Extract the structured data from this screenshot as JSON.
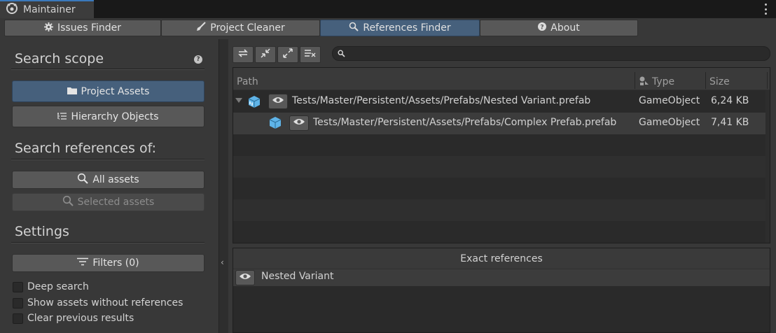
{
  "window": {
    "title": "Maintainer",
    "menu_icon": "kebab-icon"
  },
  "tabs": [
    {
      "label": "Issues Finder",
      "icon": "gear-icon",
      "active": false
    },
    {
      "label": "Project Cleaner",
      "icon": "broom-icon",
      "active": false
    },
    {
      "label": "References Finder",
      "icon": "search-icon",
      "active": true
    },
    {
      "label": "About",
      "icon": "help-icon",
      "active": false
    }
  ],
  "left": {
    "search_scope": {
      "title": "Search scope",
      "help_glyph": "?",
      "project_assets": "Project Assets",
      "hierarchy_objects": "Hierarchy Objects"
    },
    "search_refs": {
      "title": "Search references of:",
      "all_assets": "All assets",
      "selected_assets": "Selected assets"
    },
    "settings": {
      "title": "Settings",
      "filters": "Filters (0)",
      "deep_search": "Deep search",
      "show_without_refs": "Show assets without references",
      "clear_previous": "Clear previous results"
    }
  },
  "splitter": {
    "glyph": "‹"
  },
  "right": {
    "search": {
      "value": "",
      "placeholder": ""
    },
    "columns": {
      "path": "Path",
      "type": "Type",
      "size": "Size"
    },
    "rows": [
      {
        "path": "Tests/Master/Persistent/Assets/Prefabs/Nested Variant.prefab",
        "type": "GameObject",
        "size": "6,24 KB",
        "icon": "prefab-variant-icon",
        "expanded": true
      },
      {
        "path": "Tests/Master/Persistent/Assets/Prefabs/Complex Prefab.prefab",
        "type": "GameObject",
        "size": "7,41 KB",
        "icon": "prefab-icon",
        "expanded": false
      }
    ],
    "exact_refs": {
      "title": "Exact references",
      "items": [
        {
          "label": "Nested Variant"
        }
      ]
    }
  },
  "colors": {
    "accent": "#46607c",
    "background": "#383838",
    "panel_dark": "#2a2a2a",
    "prefab_blue": "#5fb4e8"
  }
}
